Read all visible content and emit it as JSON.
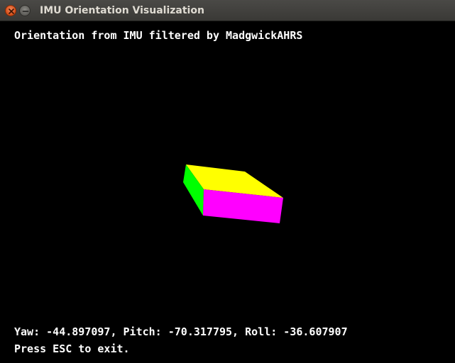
{
  "window": {
    "title": "IMU Orientation Visualization"
  },
  "overlay": {
    "heading": "Orientation from IMU filtered by MadgwickAHRS",
    "angles": "Yaw: -44.897097, Pitch: -70.317795, Roll: -36.607907",
    "hint": "Press ESC to exit."
  },
  "scene": {
    "background": "#000000",
    "faces": {
      "top": "#ffff00",
      "front": "#ff00ff",
      "side": "#00ff00"
    }
  },
  "colors": {
    "close_button": "#e05a24",
    "text": "#ffffff",
    "title_text": "#dfdbd2"
  }
}
